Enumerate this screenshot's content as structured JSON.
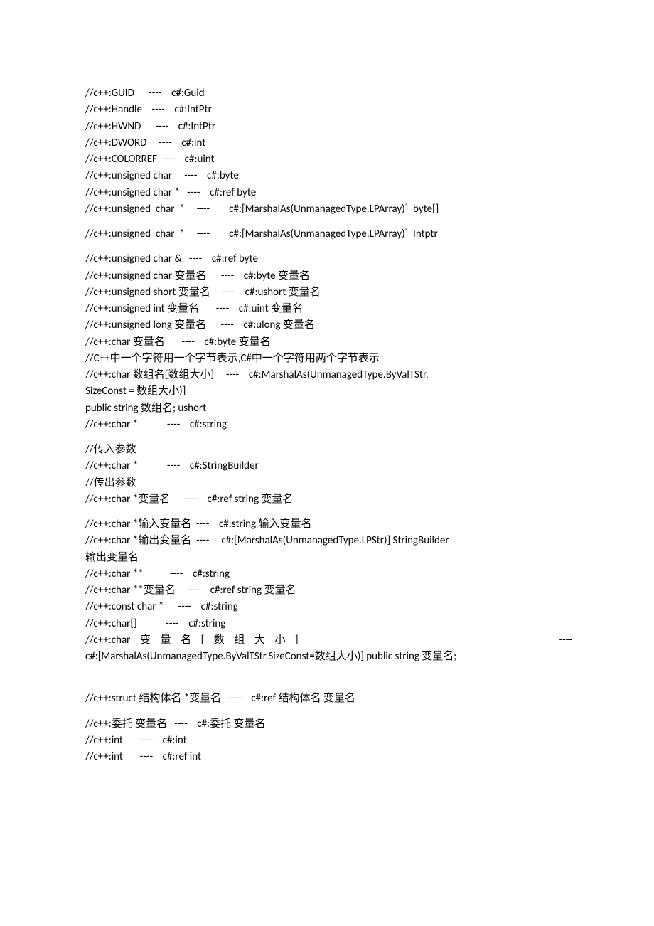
{
  "lines": {
    "l1": "//c++:GUID      ----    c#:Guid",
    "l2": "//c++:Handle    ----    c#:IntPtr",
    "l3": "//c++:HWND      ----    c#:IntPtr",
    "l4": "//c++:DWORD     ----    c#:int",
    "l5": "//c++:COLORREF  ----    c#:uint",
    "l6": "//c++:unsigned char     ----    c#:byte",
    "l7": "//c++:unsigned char *   ----    c#:ref byte",
    "l8_left": "//c++:unsigned  char  *     ----        c#:[MarshalAs(UnmanagedType.LPArray)]  byte[]",
    "l9_left": "//c++:unsigned  char  *     ----        c#:[MarshalAs(UnmanagedType.LPArray)]  Intptr",
    "l10": "//c++:unsigned char &   ----    c#:ref byte",
    "l11": "//c++:unsigned char 变量名      ----    c#:byte 变量名",
    "l12": "//c++:unsigned short 变量名     ----    c#:ushort 变量名",
    "l13": "//c++:unsigned int 变量名       ----    c#:uint 变量名",
    "l14": "//c++:unsigned long 变量名      ----    c#:ulong 变量名",
    "l15": "//c++:char 变量名       ----    c#:byte 变量名",
    "l16": "//C++中一个字符用一个字节表示,C#中一个字符用两个字节表示",
    "l17": "//c++:char 数组名[数组大小]     ----    c#:MarshalAs(UnmanagedType.ByValTStr,",
    "l18": "SizeConst = 数组大小)]",
    "l19": "public string 数组名; ushort",
    "l20": "//c++:char *            ----    c#:string",
    "l21": "//传入参数",
    "l22": "//c++:char *            ----    c#:StringBuilder",
    "l23": "//传出参数",
    "l24": "//c++:char *变量名      ----    c#:ref string 变量名",
    "l25": "//c++:char *输入变量名  ----    c#:string 输入变量名",
    "l26": "//c++:char *输出变量名  ----     c#:[MarshalAs(UnmanagedType.LPStr)] StringBuilder",
    "l27": "输出变量名",
    "l28": "//c++:char **           ----    c#:string",
    "l29": "//c++:char **变量名     ----    c#:ref string 变量名",
    "l30": "//c++:const char *      ----    c#:string",
    "l31": "//c++:char[]            ----    c#:string",
    "l32_left": "//c++:char    变    量    名    [    数    组    大    小    ]",
    "l32_right": "----",
    "l33": "c#:[MarshalAs(UnmanagedType.ByValTStr,SizeConst=数组大小)] public string 变量名;",
    "l34": "//c++:struct 结构体名 *变量名   ----    c#:ref 结构体名 变量名",
    "l35": "//c++:委托 变量名   ----    c#:委托 变量名",
    "l36": "//c++:int       ----    c#:int",
    "l37": "//c++:int       ----    c#:ref int"
  }
}
